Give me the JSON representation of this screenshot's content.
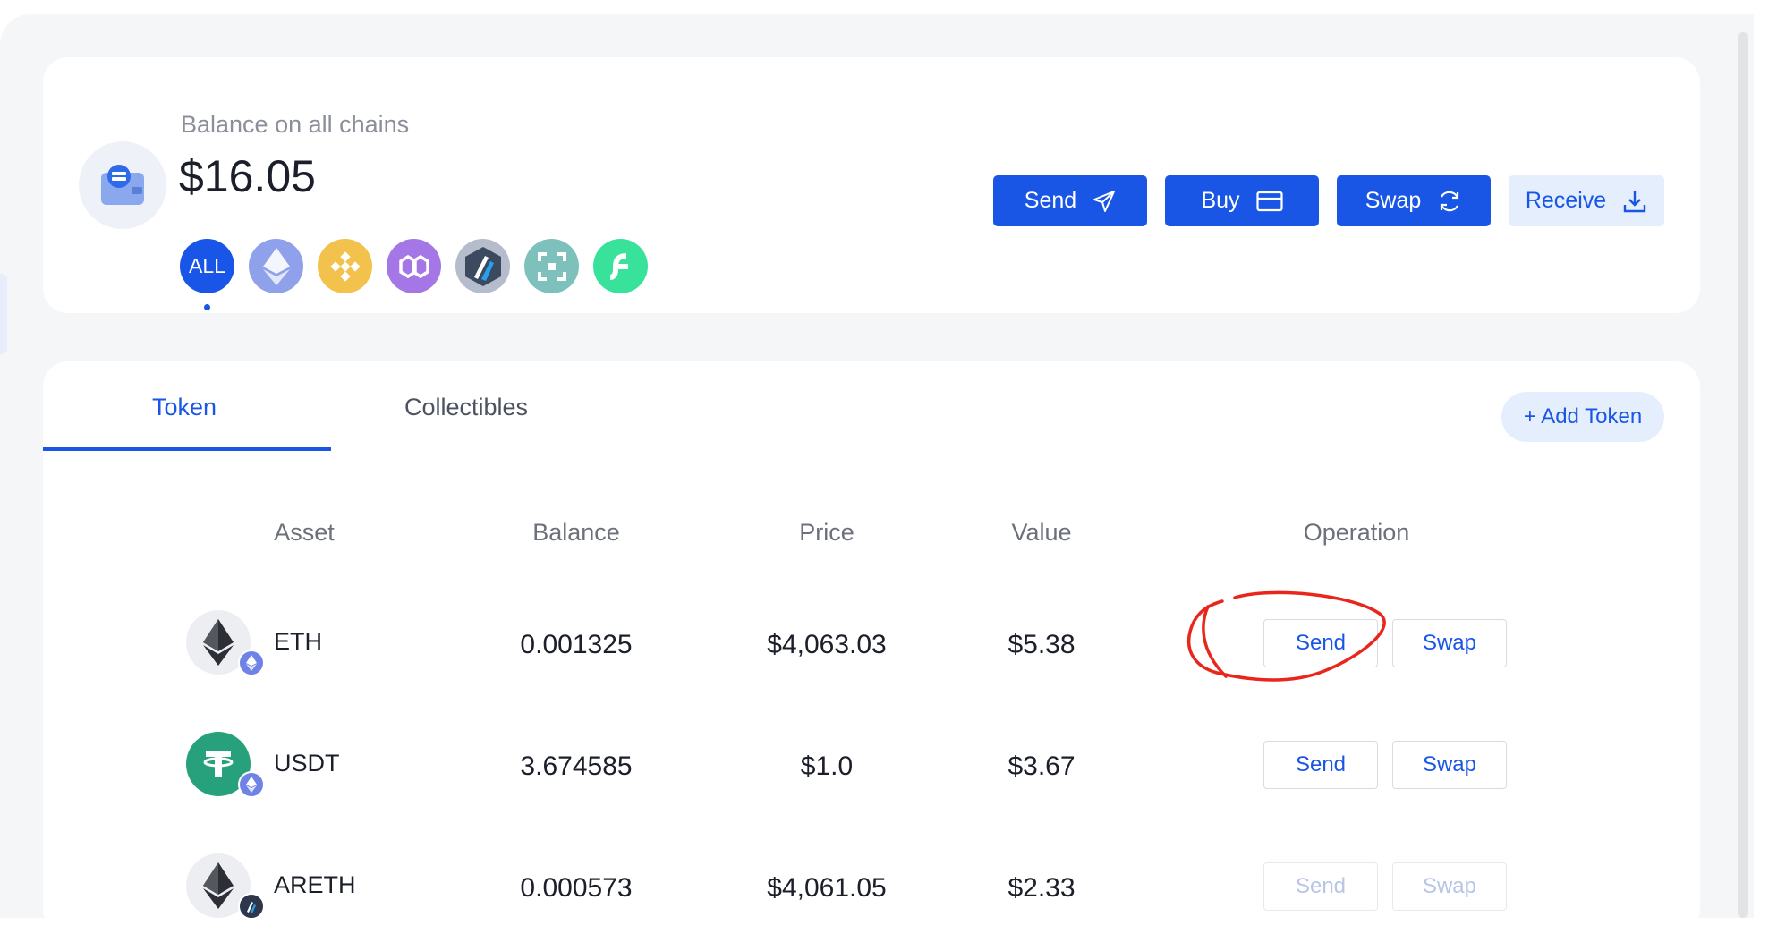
{
  "balance": {
    "label": "Balance on all chains",
    "amount": "$16.05",
    "chains": [
      {
        "name": "all",
        "label": "ALL"
      },
      {
        "name": "ethereum-icon"
      },
      {
        "name": "bnb-chain-icon"
      },
      {
        "name": "polygon-icon"
      },
      {
        "name": "arbitrum-icon"
      },
      {
        "name": "teal-chain-icon"
      },
      {
        "name": "flow-chain-icon"
      }
    ]
  },
  "actions": {
    "send": "Send",
    "buy": "Buy",
    "swap": "Swap",
    "receive": "Receive"
  },
  "tabs": {
    "token": "Token",
    "collectibles": "Collectibles",
    "add_token": "+ Add Token"
  },
  "table": {
    "headers": {
      "asset": "Asset",
      "balance": "Balance",
      "price": "Price",
      "value": "Value",
      "operation": "Operation"
    },
    "rows": [
      {
        "symbol": "ETH",
        "balance": "0.001325",
        "price": "$4,063.03",
        "value": "$5.38",
        "send": "Send",
        "swap": "Swap"
      },
      {
        "symbol": "USDT",
        "balance": "3.674585",
        "price": "$1.0",
        "value": "$3.67",
        "send": "Send",
        "swap": "Swap"
      },
      {
        "symbol": "ARETH",
        "balance": "0.000573",
        "price": "$4,061.05",
        "value": "$2.33",
        "send": "Send",
        "swap": "Swap"
      }
    ]
  },
  "colors": {
    "primary": "#1a56e6",
    "annotation": "#e8261b"
  }
}
